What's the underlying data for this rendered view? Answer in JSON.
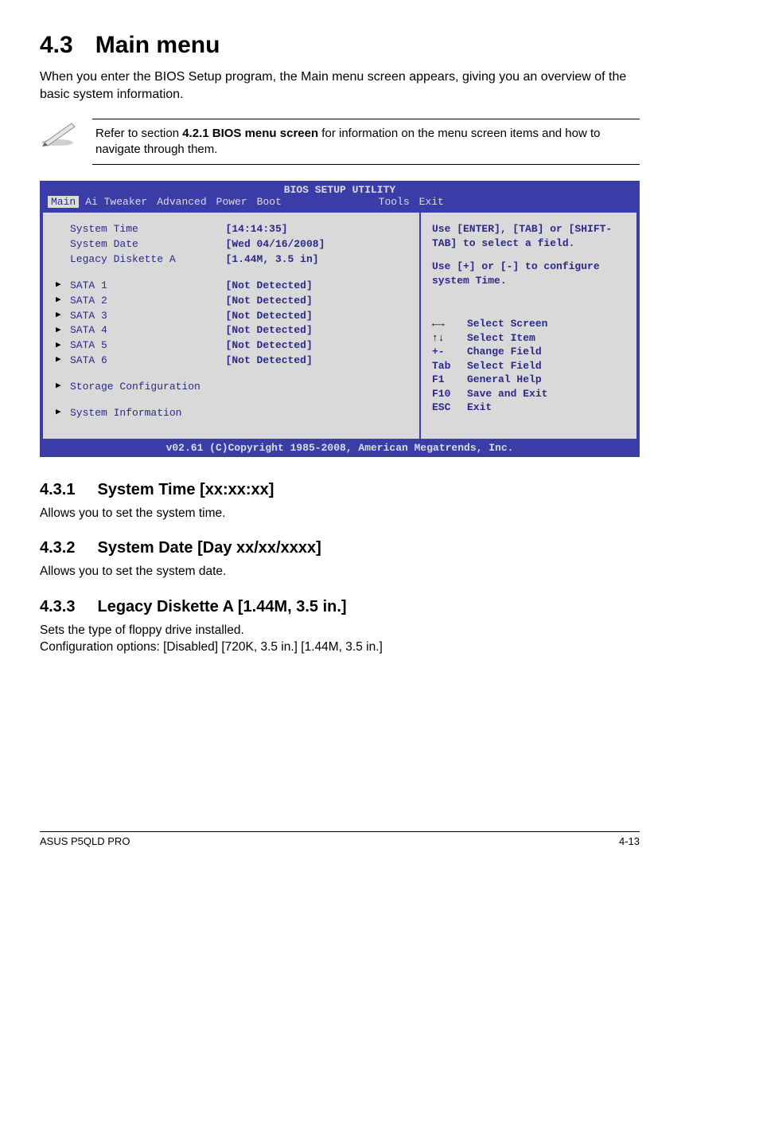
{
  "page": {
    "h1_num": "4.3",
    "h1_title": "Main menu",
    "intro": "When you enter the BIOS Setup program, the Main menu screen appears, giving you an overview of the basic system information.",
    "note_pre": "Refer to section ",
    "note_bold": "4.2.1 BIOS menu screen",
    "note_post": " for information on the menu screen items and how to navigate through them."
  },
  "bios": {
    "title": "BIOS SETUP UTILITY",
    "tabs": [
      "Main",
      "Ai Tweaker",
      "Advanced",
      "Power",
      "Boot",
      "Tools",
      "Exit"
    ],
    "selected_tab_index": 0,
    "left_top": [
      {
        "label": "System Time",
        "value": "[14:14:35]"
      },
      {
        "label": "System Date",
        "value": "[Wed 04/16/2008]"
      },
      {
        "label": "Legacy Diskette A",
        "value": "[1.44M, 3.5 in]"
      }
    ],
    "left_sata": [
      {
        "label": "SATA 1",
        "value": "[Not Detected]"
      },
      {
        "label": "SATA 2",
        "value": "[Not Detected]"
      },
      {
        "label": "SATA 3",
        "value": "[Not Detected]"
      },
      {
        "label": "SATA 4",
        "value": "[Not Detected]"
      },
      {
        "label": "SATA 5",
        "value": "[Not Detected]"
      },
      {
        "label": "SATA 6",
        "value": "[Not Detected]"
      }
    ],
    "left_links": [
      "Storage Configuration",
      "System Information"
    ],
    "right_msg1": "Use [ENTER], [TAB] or [SHIFT-TAB] to select a field.",
    "right_msg2": "Use [+] or [-] to configure system Time.",
    "help": [
      {
        "key": "←→",
        "desc": "Select Screen",
        "black": true
      },
      {
        "key": "↑↓",
        "desc": "Select Item",
        "black": true
      },
      {
        "key": "+-",
        "desc": "Change Field"
      },
      {
        "key": "Tab",
        "desc": "Select Field"
      },
      {
        "key": "F1",
        "desc": "General Help"
      },
      {
        "key": "F10",
        "desc": "Save and Exit"
      },
      {
        "key": "ESC",
        "desc": "Exit"
      }
    ],
    "footer": "v02.61 (C)Copyright 1985-2008, American Megatrends, Inc."
  },
  "sections": [
    {
      "num": "4.3.1",
      "title": "System Time [xx:xx:xx]",
      "body": "Allows you to set the system time."
    },
    {
      "num": "4.3.2",
      "title": "System Date [Day xx/xx/xxxx]",
      "body": "Allows you to set the system date."
    },
    {
      "num": "4.3.3",
      "title": "Legacy Diskette A [1.44M, 3.5 in.]",
      "body": "Sets the type of floppy drive installed.\nConfiguration options: [Disabled] [720K, 3.5 in.] [1.44M, 3.5 in.]"
    }
  ],
  "footer": {
    "left": "ASUS P5QLD PRO",
    "right": "4-13"
  }
}
